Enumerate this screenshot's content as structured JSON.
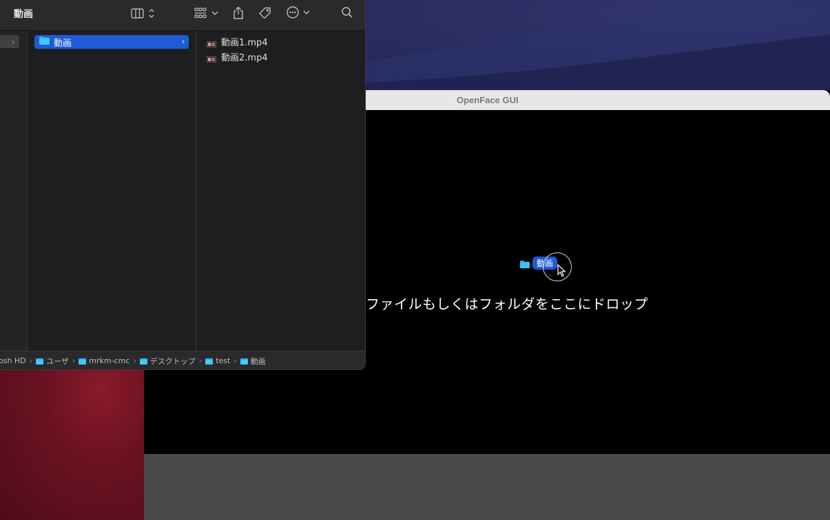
{
  "finder": {
    "title": "動画",
    "sidebar_column_chevron": "›",
    "selected_folder": "動画",
    "selected_chevron": "›",
    "files": [
      "動画1.mp4",
      "動画2.mp4"
    ],
    "pathbar": {
      "segments": [
        "osh HD",
        "ユーザ",
        "mrkm-cmc",
        "デスクトップ",
        "test",
        "動画"
      ],
      "separator": "›"
    },
    "toolbar_icons": [
      "columns-view-icon",
      "group-icon",
      "share-icon",
      "tag-icon",
      "more-icon",
      "search-icon"
    ]
  },
  "openface": {
    "title": "OpenFace GUI",
    "drop_prompt": "ファイルもしくはフォルダをここにドロップ",
    "drag_item": "動画"
  },
  "colors": {
    "selection": "#1f5bd7",
    "folder": "#2bb5f0",
    "drop_area": "#000000",
    "finder_bg": "#1e1e20"
  }
}
